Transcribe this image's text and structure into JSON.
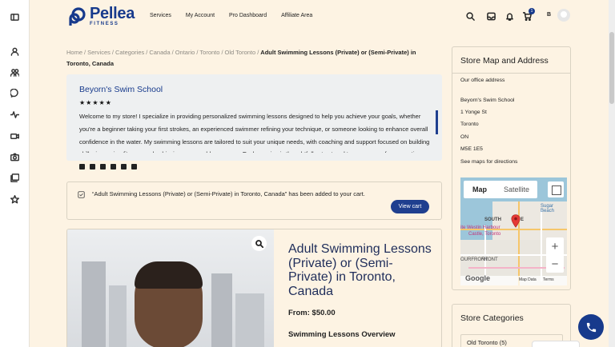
{
  "brand": {
    "name": "Pellea",
    "tagline": "FITNESS",
    "color": "#173a8c"
  },
  "nav": {
    "items": [
      "Services",
      "My Account",
      "Pro Dashboard",
      "Affiliate Area"
    ]
  },
  "header": {
    "cart_count": "1",
    "user_initial": "B"
  },
  "rail": {
    "icons": [
      "sidebar-toggle-icon",
      "user-profile-icon",
      "users-icon",
      "chat-icon",
      "activity-icon",
      "video-icon",
      "camera-icon",
      "gallery-icon",
      "star-icon"
    ]
  },
  "breadcrumb": {
    "items": [
      "Home",
      "Services",
      "Categories",
      "Canada",
      "Ontario",
      "Toronto",
      "Old Toronto"
    ],
    "separator": "/",
    "current": "Adult Swimming Lessons (Private) or (Semi-Private) in Toronto, Canada"
  },
  "store": {
    "name": "Beyorn's Swim School",
    "stars": "★★★★★",
    "rating": 5,
    "description": "Welcome to my store! I specialize in providing personalized swimming lessons designed to help you achieve your goals, whether you're a beginner taking your first strokes, an experienced swimmer refining your technique, or someone looking to enhance overall confidence in the water. My swimming lessons are tailored to suit your unique needs, with coaching and support focused on building skills, improving fitness, and achieving measurable progress. Each session is thoughtfully structured to ensure a safe, supportive, and results-driven experience. Consequently,"
  },
  "notice": {
    "text": "“Adult Swimming Lessons (Private) or (Semi-Private) in Toronto, Canada” has been added to your cart.",
    "button": "View cart"
  },
  "product": {
    "title": "Adult Swimming Lessons (Private) or (Semi-Private) in Toronto, Canada",
    "price": "From: $50.00",
    "overview_heading": "Swimming Lessons Overview"
  },
  "map_card": {
    "title": "Store Map and Address",
    "address_lines": [
      "Our office address",
      "Beyorn's Swim School",
      "1 Yonge St",
      "Toronto",
      "ON",
      "M5E 1E5",
      "See maps for directions"
    ],
    "map_tabs": [
      "Map",
      "Satellite"
    ],
    "map_labels": [
      "Sugar Beach",
      "SOUTH",
      "E",
      "ite Westin Harbour",
      "Castle, Toronto",
      "FRONT",
      "OURFRONT"
    ],
    "map_footer": [
      "Map Data",
      "Terms"
    ],
    "google_label": "Google"
  },
  "categories_card": {
    "title": "Store Categories",
    "items": [
      {
        "label": "Old Toronto",
        "count": "(5)"
      }
    ]
  }
}
